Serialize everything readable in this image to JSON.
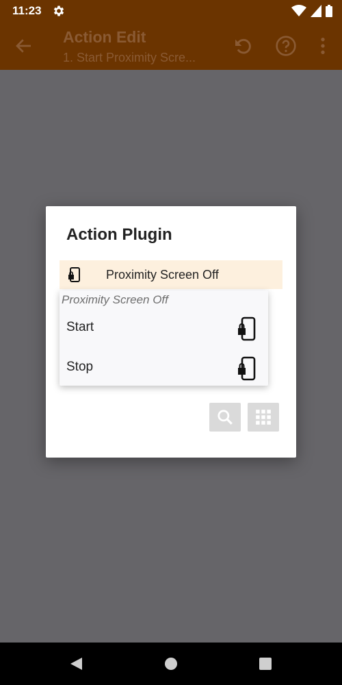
{
  "status_bar": {
    "time": "11:23",
    "icons": [
      "gear-icon",
      "wifi-icon",
      "signal-icon",
      "battery-icon"
    ]
  },
  "app_bar": {
    "title": "Action Edit",
    "subtitle": "1. Start Proximity Scre...",
    "actions": [
      "undo-icon",
      "help-icon",
      "overflow-menu-icon"
    ]
  },
  "dialog": {
    "title": "Action Plugin",
    "selected_plugin": "Proximity Screen Off",
    "popup": {
      "header": "Proximity Screen Off",
      "items": [
        {
          "label": "Start",
          "icon": "phone-lock-icon"
        },
        {
          "label": "Stop",
          "icon": "phone-lock-icon"
        }
      ]
    },
    "tools": [
      "search-icon",
      "grid-icon"
    ]
  },
  "colors": {
    "app_bar": "#6b3400",
    "scrim": "#666569",
    "selected_row": "#fdf0de",
    "tool_button": "#dadada"
  },
  "nav_bar": [
    "back-icon",
    "home-icon",
    "recents-icon"
  ]
}
